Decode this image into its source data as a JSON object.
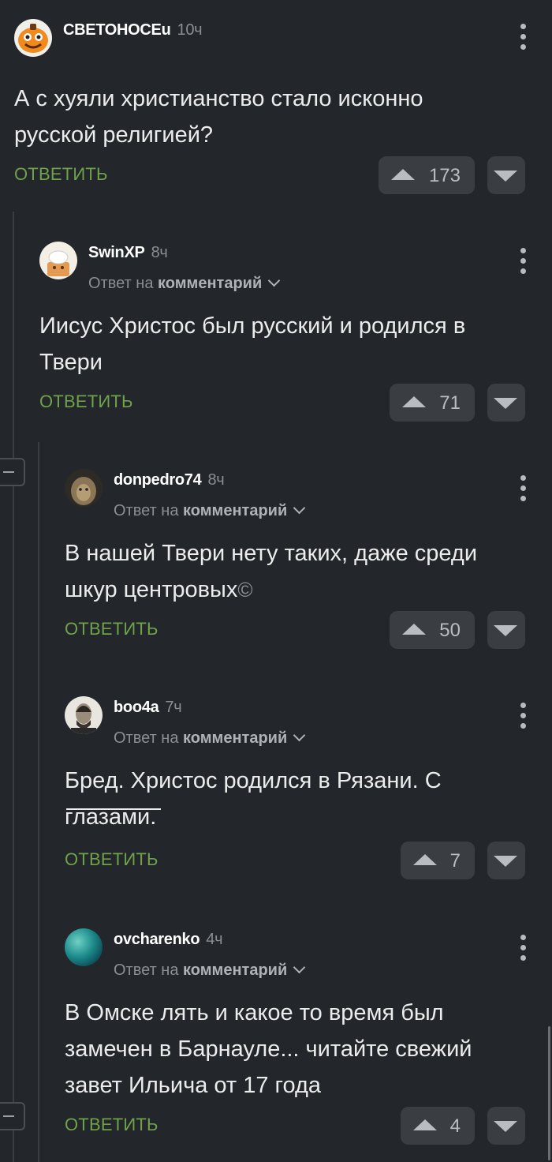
{
  "comments": [
    {
      "user": "СВЕТОНОСЕu",
      "time": "10ч",
      "text": "А с хуяли христианство стало исконно русской религией?",
      "reply_label": "ОТВЕТИТЬ",
      "rating": "173"
    },
    {
      "user": "SwinXP",
      "time": "8ч",
      "reply_prefix": "Ответ на",
      "reply_target": "комментарий",
      "text": "Иисус Христос был русский и родился в Твери",
      "reply_label": "ОТВЕТИТЬ",
      "rating": "71"
    },
    {
      "user": "donpedro74",
      "time": "8ч",
      "reply_prefix": "Ответ на",
      "reply_target": "комментарий",
      "text": "В нашей Твери нету таких, даже среди шкур центровых",
      "text_symbol": "©",
      "reply_label": "ОТВЕТИТЬ",
      "rating": "50"
    },
    {
      "user": "boo4a",
      "time": "7ч",
      "reply_prefix": "Ответ на",
      "reply_target": "комментарий",
      "text": "Бред. Христос родился в Рязани. С глазами.",
      "reply_label": "ОТВЕТИТЬ",
      "rating": "7"
    },
    {
      "user": "ovcharenko",
      "time": "4ч",
      "reply_prefix": "Ответ на",
      "reply_target": "комментарий",
      "text": "В Омске лять и какое то время был замечен в Барнауле... читайте свежий завет Ильича от 17 года",
      "reply_label": "ОТВЕТИТЬ",
      "rating": "4"
    }
  ],
  "icons": {
    "more": "more-vertical-icon",
    "upvote": "triangle-up-icon",
    "downvote": "triangle-down-icon",
    "collapse": "minus-icon",
    "expand": "chevron-down-icon"
  },
  "colors": {
    "background": "#23262a",
    "reply_link": "#6fa24a",
    "vote_button": "#3a3d42",
    "muted_text": "#8a8f95"
  }
}
